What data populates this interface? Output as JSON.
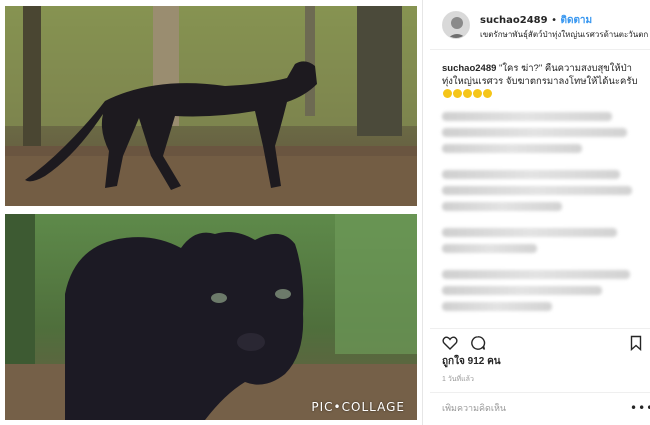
{
  "header": {
    "username": "suchao2489",
    "separator": "•",
    "follow_label": "ติดตาม",
    "location": "เขตรักษาพันธุ์สัตว์ป่าทุ่งใหญ่นเรศวรด้านตะวันตก"
  },
  "caption": {
    "username": "suchao2489",
    "text": "\"ใคร ฆ่า?\" คืนความสงบสุขให้ป่าทุ่งใหญ่นเรศวร จับฆาตกรมาลงโทษให้ได้นะครับ",
    "emoji_icons": [
      "smile-emoji-icon",
      "smile-emoji-icon",
      "smile-emoji-icon",
      "smile-emoji-icon",
      "smile-emoji-icon"
    ]
  },
  "photos": {
    "watermark": "PIC•COLLAGE"
  },
  "actions": {
    "icons": [
      "heart-icon",
      "comment-bubble-icon",
      "bookmark-icon"
    ]
  },
  "likes": "ถูกใจ 912 คน",
  "time": "1 วันที่แล้ว",
  "comment_input": {
    "placeholder": "เพิ่มความคิดเห็น",
    "more_label": "•••"
  },
  "colors": {
    "follow": "#3897f0",
    "text": "#262626",
    "muted": "#999999",
    "divider": "#efefef"
  }
}
